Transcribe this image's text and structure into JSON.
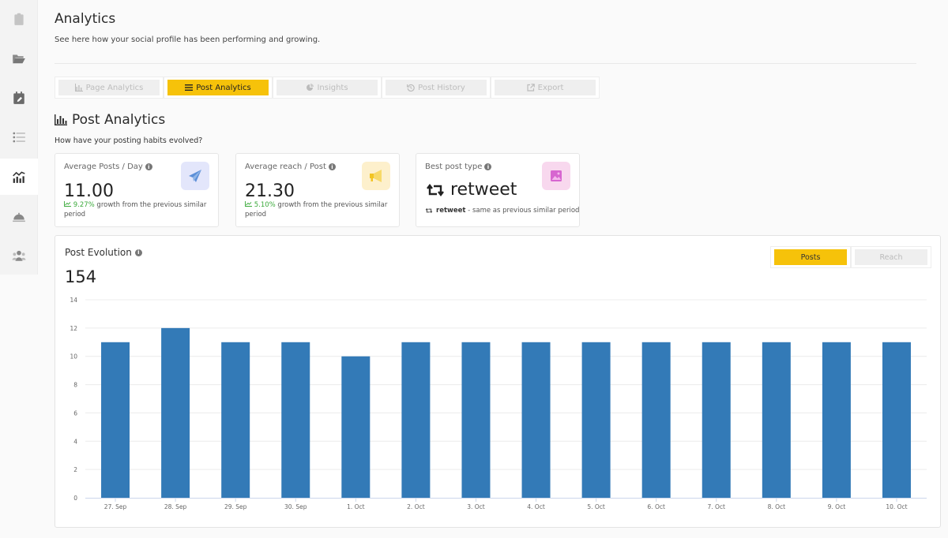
{
  "sidebar": {
    "items": [
      {
        "name": "clipboard",
        "active": false
      },
      {
        "name": "folder-open",
        "active": false
      },
      {
        "name": "calendar-edit",
        "active": false
      },
      {
        "name": "list",
        "active": false
      },
      {
        "name": "analytics-chart",
        "active": true
      },
      {
        "name": "service-bell",
        "active": false
      },
      {
        "name": "users-group",
        "active": false
      }
    ]
  },
  "header": {
    "title": "Analytics",
    "subtitle": "See here how your social profile has been performing and growing."
  },
  "tabs": [
    {
      "label": "Page Analytics",
      "icon": "bar-chart-icon",
      "active": false
    },
    {
      "label": "Post Analytics",
      "icon": "bars-icon",
      "active": true
    },
    {
      "label": "Insights",
      "icon": "pie-chart-icon",
      "active": false
    },
    {
      "label": "Post History",
      "icon": "history-icon",
      "active": false
    },
    {
      "label": "Export",
      "icon": "external-link-icon",
      "active": false
    }
  ],
  "section": {
    "title": "Post Analytics",
    "subtitle": "How have your posting habits evolved?"
  },
  "cards": {
    "avg_posts": {
      "label": "Average Posts / Day",
      "value": "11.00",
      "growth_pct": "9.27%",
      "growth_text": "growth from the previous similar period",
      "icon": "paper-plane-icon",
      "icon_bg": "#e3e6fb",
      "icon_color": "#5b8fd8"
    },
    "avg_reach": {
      "label": "Average reach / Post",
      "value": "21.30",
      "growth_pct": "5.10%",
      "growth_text": "growth from the previous similar period",
      "icon": "megaphone-icon",
      "icon_bg": "#fdf0cc",
      "icon_color": "#f2c422"
    },
    "best_type": {
      "label": "Best post type",
      "value": "retweet",
      "note_bold": "retweet",
      "note_text": " - same as previous similar period",
      "icon": "image-icon",
      "icon_bg": "#f8d8ee",
      "icon_color": "#d766d0"
    }
  },
  "post_evolution": {
    "title": "Post Evolution",
    "total": "154",
    "toggles": [
      {
        "label": "Posts",
        "active": true
      },
      {
        "label": "Reach",
        "active": false
      }
    ]
  },
  "colors": {
    "accent": "#f6c20a",
    "bar": "#337ab7",
    "growth": "#3caa3c"
  },
  "chart_data": {
    "type": "bar",
    "title": "Post Evolution",
    "categories": [
      "27. Sep",
      "28. Sep",
      "29. Sep",
      "30. Sep",
      "1. Oct",
      "2. Oct",
      "3. Oct",
      "4. Oct",
      "5. Oct",
      "6. Oct",
      "7. Oct",
      "8. Oct",
      "9. Oct",
      "10. Oct"
    ],
    "values": [
      11,
      12,
      11,
      11,
      10,
      11,
      11,
      11,
      11,
      11,
      11,
      11,
      11,
      11
    ],
    "yticks": [
      0,
      2,
      4,
      6,
      8,
      10,
      12,
      14
    ],
    "ylim": [
      0,
      14
    ],
    "xlabel": "",
    "ylabel": "",
    "grid": true,
    "legend": "none"
  }
}
